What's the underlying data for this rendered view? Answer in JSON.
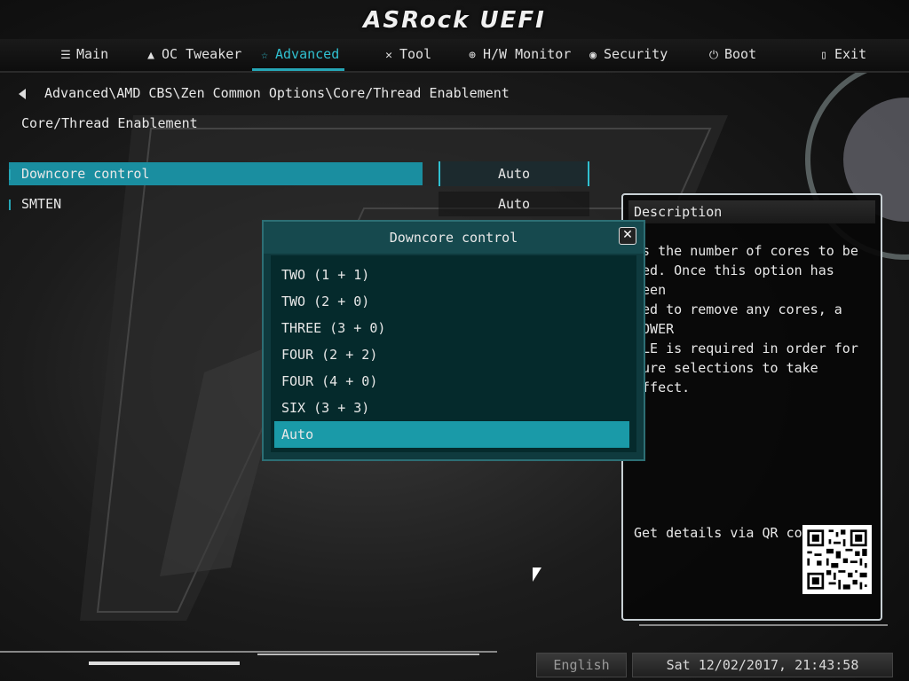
{
  "header": {
    "logo_text": "ASRock UEFI"
  },
  "nav": {
    "tabs": [
      {
        "label": "Main",
        "icon": "list-icon"
      },
      {
        "label": "OC Tweaker",
        "icon": "rocket-icon"
      },
      {
        "label": "Advanced",
        "icon": "star-icon",
        "active": true
      },
      {
        "label": "Tool",
        "icon": "tools-icon"
      },
      {
        "label": "H/W Monitor",
        "icon": "monitor-icon"
      },
      {
        "label": "Security",
        "icon": "shield-icon"
      },
      {
        "label": "Boot",
        "icon": "power-icon"
      },
      {
        "label": "Exit",
        "icon": "exit-icon"
      }
    ]
  },
  "breadcrumb": {
    "path": "Advanced\\AMD CBS\\Zen Common Options\\Core/Thread Enablement"
  },
  "page": {
    "title": "Core/Thread Enablement"
  },
  "settings": [
    {
      "label": "Downcore control",
      "value": "Auto",
      "selected": true
    },
    {
      "label": "SMTEN",
      "value": "Auto",
      "selected": false
    }
  ],
  "popup": {
    "title": "Downcore control",
    "options": [
      "TWO (1 + 1)",
      "TWO (2 + 0)",
      "THREE (3 + 0)",
      "FOUR (2 + 2)",
      "FOUR (4 + 0)",
      "SIX (3 + 3)",
      "Auto"
    ],
    "selected_index": 6
  },
  "description": {
    "title": "Description",
    "text": "ts the number of cores to be\nsed. Once this option has been\nsed to remove any cores, a POWER\nCLE is required in order for\nture selections to take effect.",
    "qr_label": "Get details via QR code"
  },
  "footer": {
    "language": "English",
    "datetime": "Sat 12/02/2017, 21:43:58"
  },
  "colors": {
    "accent": "#26a6b6",
    "selected_row": "#1a8ea0",
    "popup_bg": "#0f3a3e"
  }
}
